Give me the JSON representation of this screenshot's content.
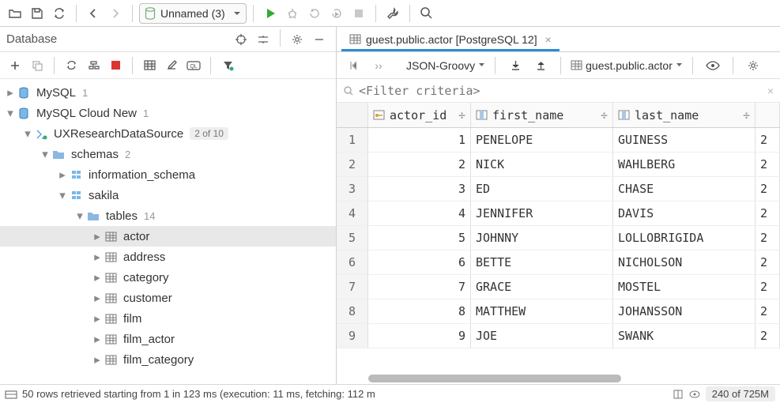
{
  "top": {
    "combo_label": "Unnamed (3)"
  },
  "left": {
    "title": "Database"
  },
  "tree": {
    "mysql": {
      "label": "MySQL",
      "count": "1"
    },
    "mysql_cloud": {
      "label": "MySQL Cloud New",
      "count": "1"
    },
    "ux": {
      "label": "UXResearchDataSource",
      "badge": "2 of 10"
    },
    "schemas": {
      "label": "schemas",
      "count": "2"
    },
    "info_schema": {
      "label": "information_schema"
    },
    "sakila": {
      "label": "sakila"
    },
    "tables": {
      "label": "tables",
      "count": "14"
    },
    "tbl": {
      "actor": "actor",
      "address": "address",
      "category": "category",
      "customer": "customer",
      "film": "film",
      "film_actor": "film_actor",
      "film_category": "film_category"
    }
  },
  "editor": {
    "tab_label": "guest.public.actor [PostgreSQL 12]",
    "breadcrumb": "guest.public.actor",
    "view_mode": "JSON-Groovy",
    "filter_placeholder": "<Filter criteria>"
  },
  "columns": {
    "c1": "actor_id",
    "c2": "first_name",
    "c3": "last_name"
  },
  "rows": [
    {
      "n": "1",
      "id": "1",
      "fn": "PENELOPE",
      "ln": "GUINESS",
      "lu": "2"
    },
    {
      "n": "2",
      "id": "2",
      "fn": "NICK",
      "ln": "WAHLBERG",
      "lu": "2"
    },
    {
      "n": "3",
      "id": "3",
      "fn": "ED",
      "ln": "CHASE",
      "lu": "2"
    },
    {
      "n": "4",
      "id": "4",
      "fn": "JENNIFER",
      "ln": "DAVIS",
      "lu": "2"
    },
    {
      "n": "5",
      "id": "5",
      "fn": "JOHNNY",
      "ln": "LOLLOBRIGIDA",
      "lu": "2"
    },
    {
      "n": "6",
      "id": "6",
      "fn": "BETTE",
      "ln": "NICHOLSON",
      "lu": "2"
    },
    {
      "n": "7",
      "id": "7",
      "fn": "GRACE",
      "ln": "MOSTEL",
      "lu": "2"
    },
    {
      "n": "8",
      "id": "8",
      "fn": "MATTHEW",
      "ln": "JOHANSSON",
      "lu": "2"
    },
    {
      "n": "9",
      "id": "9",
      "fn": "JOE",
      "ln": "SWANK",
      "lu": "2"
    }
  ],
  "status": {
    "msg": "50 rows retrieved starting from 1 in 123 ms (execution: 11 ms, fetching: 112 m",
    "mem": "240 of 725M"
  }
}
